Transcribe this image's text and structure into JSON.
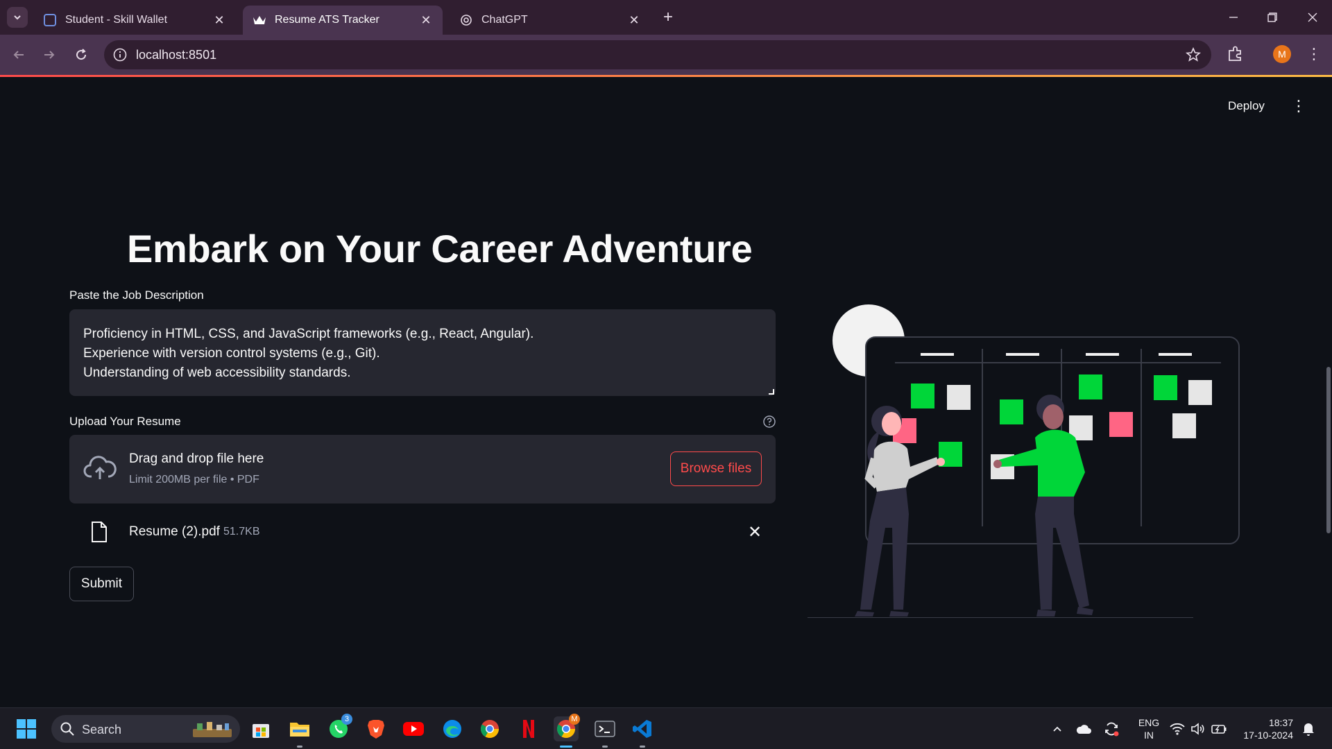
{
  "browser": {
    "tabs": [
      {
        "label": "Student - Skill Wallet",
        "active": false
      },
      {
        "label": "Resume ATS Tracker",
        "active": true
      },
      {
        "label": "ChatGPT",
        "active": false
      }
    ],
    "url": "localhost:8501",
    "profile_initial": "M"
  },
  "app": {
    "deploy_label": "Deploy",
    "title": "Embark on Your Career Adventure",
    "job_description": {
      "label": "Paste the Job Description",
      "lines": [
        "Proficiency in HTML, CSS, and JavaScript frameworks (e.g., React, Angular).",
        "Experience with version control systems (e.g., Git).",
        "Understanding of web accessibility standards."
      ]
    },
    "upload": {
      "label": "Upload Your Resume",
      "dropzone_title": "Drag and drop file here",
      "dropzone_limit": "Limit 200MB per file • PDF",
      "browse_label": "Browse files",
      "file_name": "Resume (2).pdf",
      "file_size": "51.7KB"
    },
    "submit_label": "Submit"
  },
  "taskbar": {
    "search_placeholder": "Search",
    "whatsapp_badge": "3",
    "chrome_badge": "M",
    "language": "ENG",
    "region": "IN",
    "time": "18:37",
    "date": "17-10-2024"
  },
  "colors": {
    "accent": "#ff4b4b",
    "illustration_green": "#00d639",
    "illustration_pink": "#ff6584",
    "background": "#0e1117"
  }
}
